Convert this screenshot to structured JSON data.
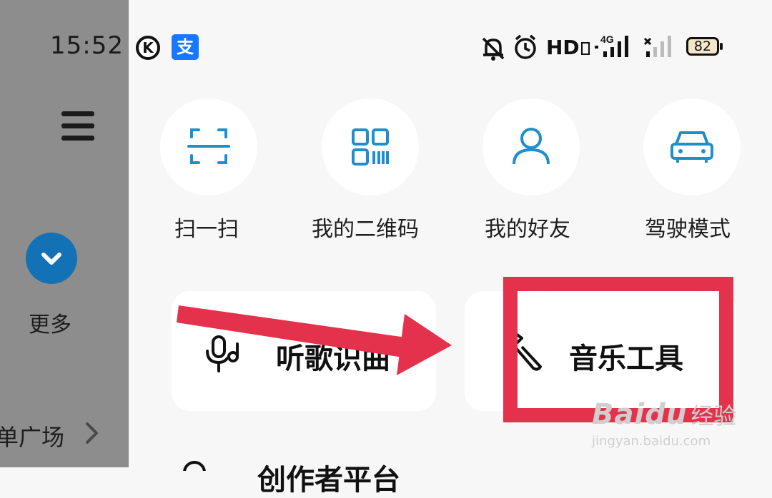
{
  "status_bar": {
    "time": "15:52",
    "k_icon_letter": "K",
    "alipay_glyph": "支",
    "hd_label": "HD",
    "network_label": "4G",
    "battery": "82"
  },
  "sidebar": {
    "more_label": "更多",
    "square_label": "单广场"
  },
  "quick_actions": [
    {
      "label": "扫一扫",
      "icon": "scan-icon"
    },
    {
      "label": "我的二维码",
      "icon": "qrcode-icon"
    },
    {
      "label": "我的好友",
      "icon": "friends-icon"
    },
    {
      "label": "驾驶模式",
      "icon": "car-icon"
    }
  ],
  "cards": {
    "listen_label": "听歌识曲",
    "tools_label": "音乐工具"
  },
  "bottom_row": {
    "partial_label": "创作者平台"
  },
  "watermark": {
    "brand": "Bai",
    "brand_suffix": "du",
    "brand_cn": "经验",
    "url": "jingyan.baidu.com"
  },
  "colors": {
    "accent_icon": "#1e8fcd",
    "annotation_red": "#e5324c",
    "more_button": "#1272b5"
  }
}
